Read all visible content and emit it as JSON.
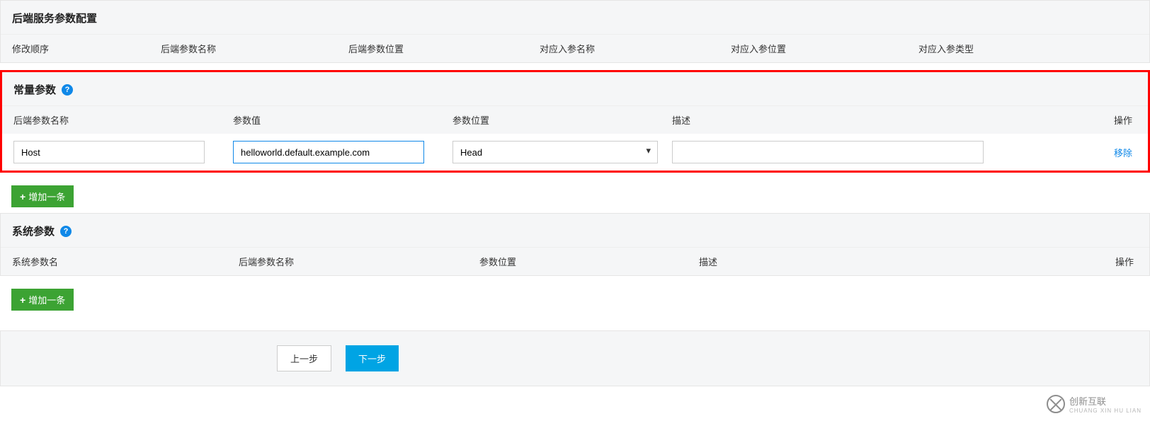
{
  "backend": {
    "title": "后端服务参数配置",
    "cols": [
      "修改顺序",
      "后端参数名称",
      "后端参数位置",
      "对应入参名称",
      "对应入参位置",
      "对应入参类型"
    ]
  },
  "constant": {
    "title": "常量参数",
    "cols": [
      "后端参数名称",
      "参数值",
      "参数位置",
      "描述",
      "操作"
    ],
    "row": {
      "name": "Host",
      "value": "helloworld.default.example.com",
      "location": "Head",
      "desc": "",
      "remove": "移除"
    },
    "add": "增加一条"
  },
  "system": {
    "title": "系统参数",
    "cols": [
      "系统参数名",
      "后端参数名称",
      "参数位置",
      "描述",
      "操作"
    ],
    "add": "增加一条"
  },
  "footer": {
    "prev": "上一步",
    "next": "下一步"
  },
  "brand": {
    "name": "创新互联",
    "sub": "CHUANG XIN HU LIAN"
  }
}
